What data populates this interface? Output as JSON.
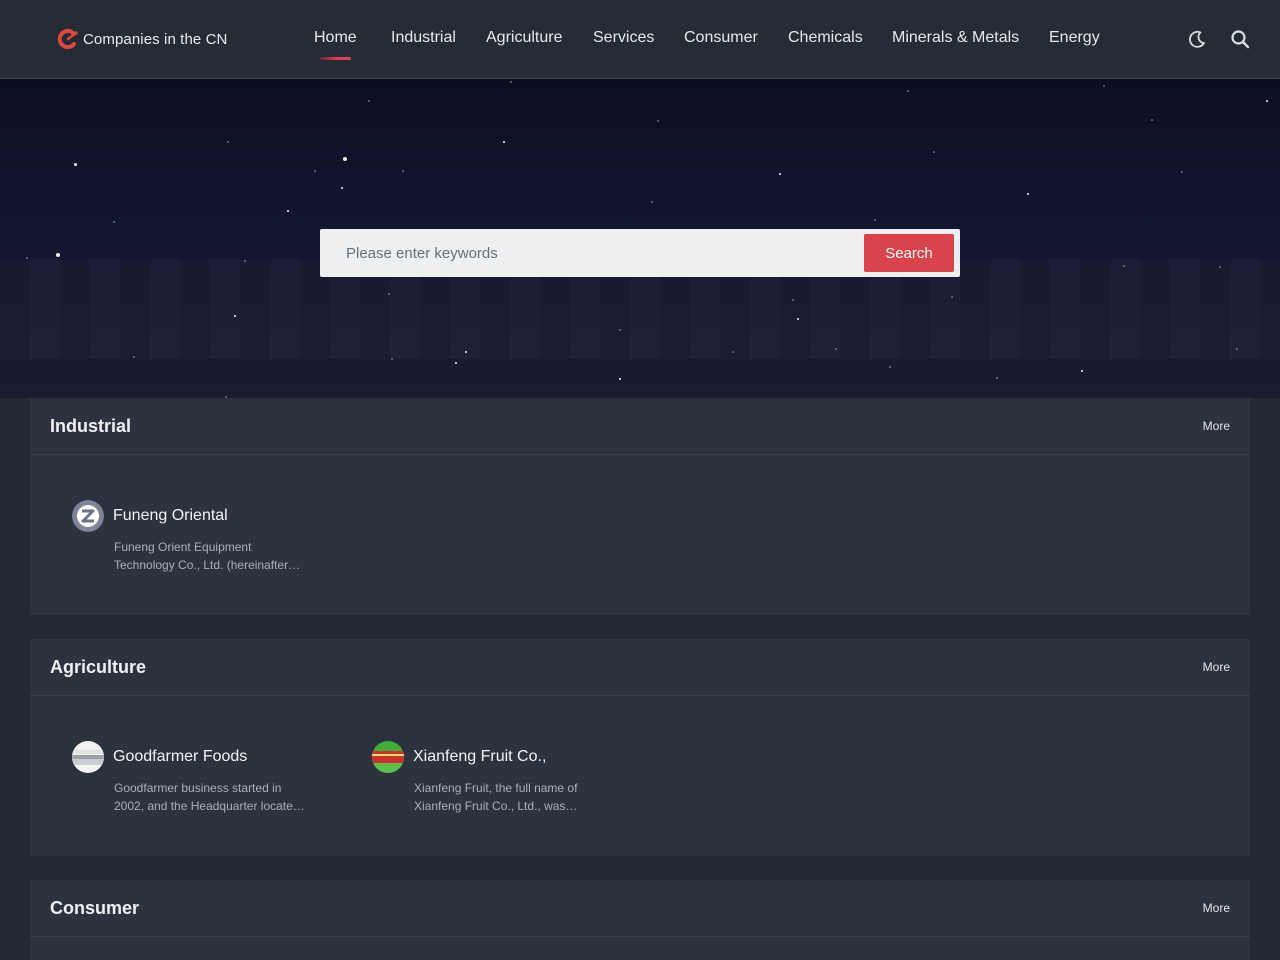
{
  "site": {
    "logo_text": "Companies in the CN",
    "brand_color": "#e0473f"
  },
  "nav": {
    "items": [
      {
        "label": "Home",
        "active": true
      },
      {
        "label": "Industrial"
      },
      {
        "label": "Agriculture"
      },
      {
        "label": "Services"
      },
      {
        "label": "Consumer"
      },
      {
        "label": "Chemicals"
      },
      {
        "label": "Minerals & Metals"
      },
      {
        "label": "Energy"
      }
    ],
    "icons": [
      "moon-icon",
      "search-icon"
    ]
  },
  "search": {
    "placeholder": "Please enter keywords",
    "value": "",
    "button_label": "Search",
    "button_color": "#d9434b"
  },
  "sections": [
    {
      "title": "Industrial",
      "more_label": "More",
      "companies": [
        {
          "name": "Funeng Oriental",
          "desc": "Funeng Orient Equipment Technology Co., Ltd. (hereinafter…"
        }
      ]
    },
    {
      "title": "Agriculture",
      "more_label": "More",
      "companies": [
        {
          "name": "Goodfarmer Foods",
          "desc": "Goodfarmer business started in 2002, and the Headquarter locate…"
        },
        {
          "name": "Xianfeng Fruit Co.,",
          "desc": "Xianfeng Fruit, the full name of Xianfeng Fruit Co., Ltd., was…"
        }
      ]
    },
    {
      "title": "Consumer",
      "more_label": "More",
      "companies": []
    }
  ]
}
